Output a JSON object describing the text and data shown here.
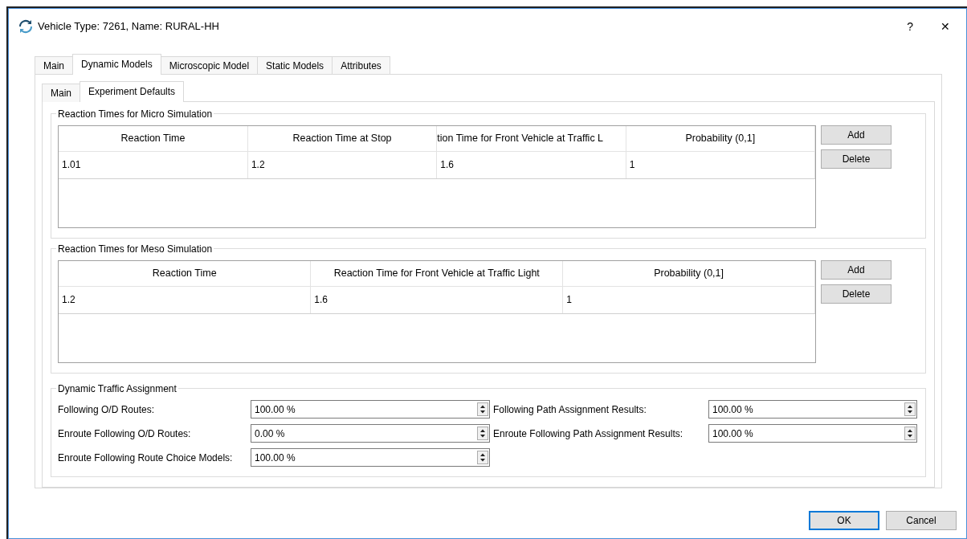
{
  "window": {
    "title": "Vehicle Type: 7261, Name: RURAL-HH",
    "help": "?",
    "close": "✕"
  },
  "tabs": [
    {
      "label": "Main",
      "selected": false
    },
    {
      "label": "Dynamic Models",
      "selected": true
    },
    {
      "label": "Microscopic Model",
      "selected": false
    },
    {
      "label": "Static Models",
      "selected": false
    },
    {
      "label": "Attributes",
      "selected": false
    }
  ],
  "subtabs": [
    {
      "label": "Main",
      "selected": false
    },
    {
      "label": "Experiment Defaults",
      "selected": true
    }
  ],
  "groups": [
    {
      "title": "Reaction Times for Micro Simulation",
      "columns": [
        "Reaction Time",
        "Reaction Time at Stop",
        "tion Time for Front Vehicle at Traffic L",
        "Probability (0,1]"
      ],
      "rows": [
        [
          "1.01",
          "1.2",
          "1.6",
          "1"
        ]
      ],
      "buttons": [
        "Add",
        "Delete"
      ]
    },
    {
      "title": "Reaction Times for Meso Simulation",
      "columns": [
        "Reaction Time",
        "Reaction Time for Front Vehicle at Traffic Light",
        "Probability (0,1]"
      ],
      "rows": [
        [
          "1.2",
          "1.6",
          "1"
        ]
      ],
      "buttons": [
        "Add",
        "Delete"
      ]
    }
  ],
  "assignment": {
    "title": "Dynamic Traffic Assignment",
    "fields": [
      {
        "label": "Following O/D Routes:",
        "value": "100.00 %"
      },
      {
        "label": "Following Path Assignment Results:",
        "value": "100.00 %"
      },
      {
        "label": "Enroute Following O/D Routes:",
        "value": "0.00 %"
      },
      {
        "label": "Enroute Following Path Assignment Results:",
        "value": "100.00 %"
      },
      {
        "label": "Enroute Following Route Choice Models:",
        "value": "100.00 %"
      }
    ]
  },
  "footer": [
    {
      "label": "OK",
      "default": true
    },
    {
      "label": "Cancel",
      "default": false
    }
  ]
}
